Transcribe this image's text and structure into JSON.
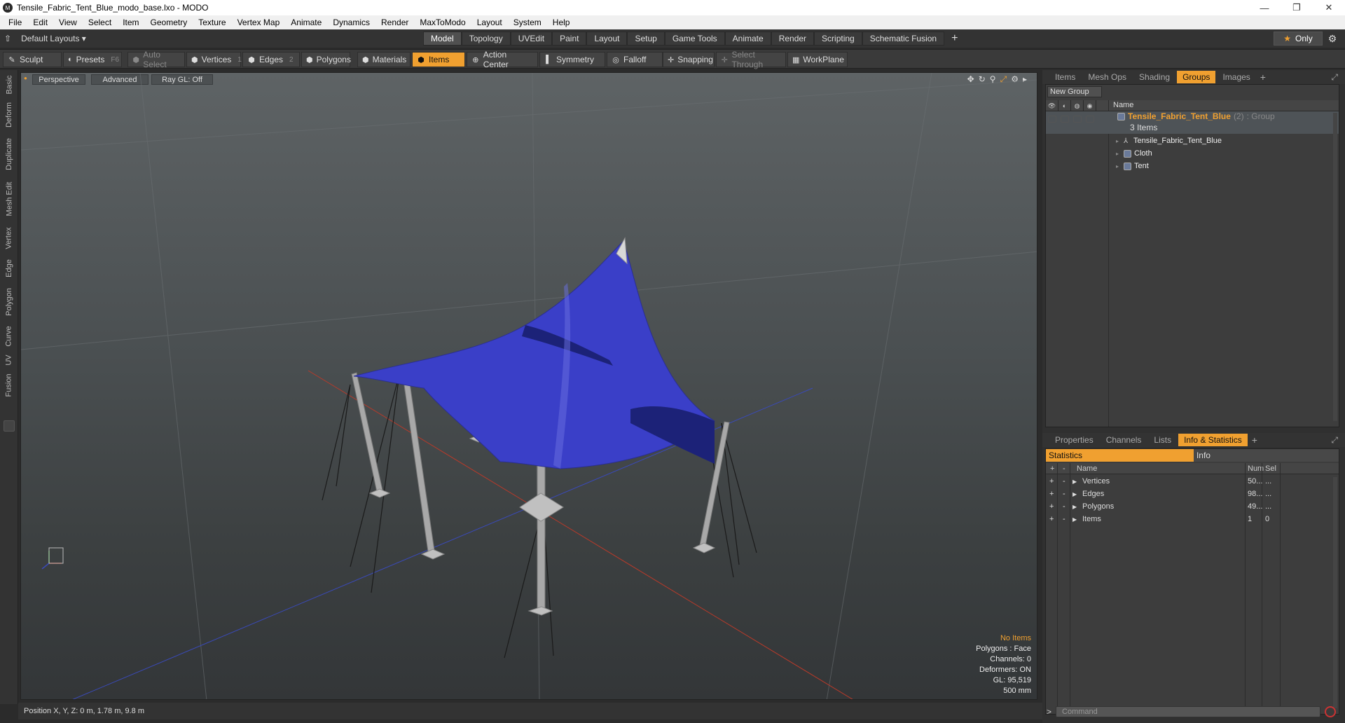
{
  "window": {
    "title": "Tensile_Fabric_Tent_Blue_modo_base.lxo - MODO",
    "app_icon": "modo-logo-icon",
    "controls": [
      "—",
      "❐",
      "✕"
    ]
  },
  "menu": [
    "File",
    "Edit",
    "View",
    "Select",
    "Item",
    "Geometry",
    "Texture",
    "Vertex Map",
    "Animate",
    "Dynamics",
    "Render",
    "MaxToModo",
    "Layout",
    "System",
    "Help"
  ],
  "layouts": {
    "label": "Default Layouts ▾"
  },
  "mode_tabs": [
    {
      "label": "Model",
      "active": true
    },
    {
      "label": "Topology"
    },
    {
      "label": "UVEdit"
    },
    {
      "label": "Paint"
    },
    {
      "label": "Layout"
    },
    {
      "label": "Setup"
    },
    {
      "label": "Game Tools"
    },
    {
      "label": "Animate"
    },
    {
      "label": "Render"
    },
    {
      "label": "Scripting"
    },
    {
      "label": "Schematic Fusion"
    },
    {
      "label": "+"
    }
  ],
  "only_button": {
    "star": "★",
    "label": "Only"
  },
  "toolbar": {
    "sculpt": "Sculpt",
    "presets": "Presets",
    "presets_key": "F6",
    "auto_select": "Auto Select",
    "vertices": "Vertices",
    "vertices_key": "1",
    "edges": "Edges",
    "edges_key": "2",
    "polygons": "Polygons",
    "materials": "Materials",
    "items": "Items",
    "action_center": "Action Center",
    "symmetry": "Symmetry",
    "falloff": "Falloff",
    "snapping": "Snapping",
    "select_through": "Select Through",
    "workplane": "WorkPlane"
  },
  "left_tabs": [
    "Basic",
    "Deform",
    "Duplicate",
    "Mesh Edit",
    "Vertex",
    "Edge",
    "Polygon",
    "Curve",
    "UV",
    "Fusion"
  ],
  "viewport": {
    "perspective": "Perspective",
    "advanced": "Advanced",
    "raygl": "Ray GL: Off",
    "info": {
      "no_items": "No Items",
      "polygons": "Polygons : Face",
      "channels": "Channels: 0",
      "deformers": "Deformers: ON",
      "gl": "GL: 95,519",
      "scale": "500 mm"
    },
    "colors": {
      "fabric": "#3a3fc8",
      "fabric_dark": "#1c2278",
      "pole": "#a8a8a8",
      "x_axis": "#b83a2a",
      "z_axis": "#3a4ab8"
    }
  },
  "status": {
    "position": "Position X, Y, Z:  0 m, 1.78 m, 9.8 m"
  },
  "panel_top": {
    "tabs": [
      "Items",
      "Mesh Ops",
      "Shading",
      "Groups",
      "Images",
      "+"
    ],
    "active": "Groups",
    "new_group": "New Group",
    "name_header": "Name",
    "group": {
      "name": "Tensile_Fabric_Tent_Blue",
      "count": "(2)",
      "type": ": Group",
      "items_count": "3 Items"
    },
    "children": [
      "Tensile_Fabric_Tent_Blue",
      "Cloth",
      "Tent"
    ]
  },
  "panel_bottom": {
    "tabs": [
      "Properties",
      "Channels",
      "Lists",
      "Info & Statistics",
      "+"
    ],
    "active": "Info & Statistics",
    "subtabs": [
      "Statistics",
      "Info"
    ],
    "headers": {
      "name": "Name",
      "num": "Num",
      "sel": "Sel"
    },
    "rows": [
      {
        "name": "Vertices",
        "num": "50...",
        "sel": "..."
      },
      {
        "name": "Edges",
        "num": "98...",
        "sel": "..."
      },
      {
        "name": "Polygons",
        "num": "49...",
        "sel": "..."
      },
      {
        "name": "Items",
        "num": "1",
        "sel": "0"
      }
    ]
  },
  "command": {
    "prompt": ">",
    "placeholder": "Command"
  }
}
